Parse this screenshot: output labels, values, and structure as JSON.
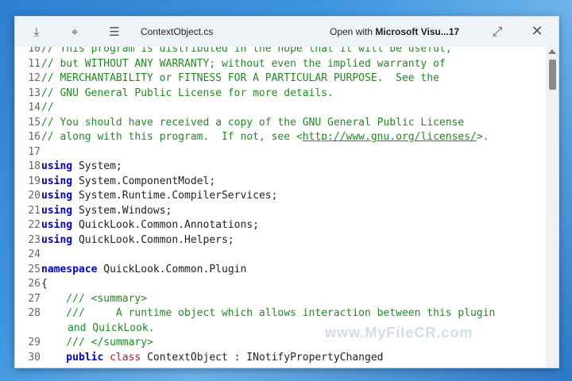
{
  "titlebar": {
    "file_name": "ContextObject.cs",
    "open_with_prefix": "Open with",
    "open_with_app": "Microsoft Visu...17",
    "icons": [
      "pin-top-icon",
      "pin-icon",
      "list-icon",
      "fullscreen-icon",
      "close-icon"
    ]
  },
  "code": {
    "lines": [
      {
        "n": "10",
        "text": "// This program is distributed in the hope that it will be useful,"
      },
      {
        "n": "11",
        "text": "// but WITHOUT ANY WARRANTY; without even the implied warranty of"
      },
      {
        "n": "12",
        "text": "// MERCHANTABILITY or FITNESS FOR A PARTICULAR PURPOSE.  See the"
      },
      {
        "n": "13",
        "text": "// GNU General Public License for more details."
      },
      {
        "n": "14",
        "text": "//"
      },
      {
        "n": "15",
        "text": "// You should have received a copy of the GNU General Public License"
      },
      {
        "n": "16",
        "pre": "// along with this program.  If not, see <",
        "link": "http://www.gnu.org/licenses/",
        "post": ">."
      },
      {
        "n": "17",
        "text": ""
      },
      {
        "n": "18",
        "kw": "using",
        "rest": " System;"
      },
      {
        "n": "19",
        "kw": "using",
        "rest": " System.ComponentModel;"
      },
      {
        "n": "20",
        "kw": "using",
        "rest": " System.Runtime.CompilerServices;"
      },
      {
        "n": "21",
        "kw": "using",
        "rest": " System.Windows;"
      },
      {
        "n": "22",
        "kw": "using",
        "rest": " QuickLook.Common.Annotations;"
      },
      {
        "n": "23",
        "kw": "using",
        "rest": " QuickLook.Common.Helpers;"
      },
      {
        "n": "24",
        "text": ""
      },
      {
        "n": "25",
        "kw": "namespace",
        "rest": " QuickLook.Common.Plugin"
      },
      {
        "n": "26",
        "rest": "{"
      },
      {
        "n": "27",
        "text": "    /// <summary>"
      },
      {
        "n": "28",
        "text": "    ///     A runtime object which allows interaction between this plugin",
        "cont": "and QuickLook."
      },
      {
        "n": "29",
        "text": "    /// </summary>"
      },
      {
        "n": "30",
        "kw": "    public",
        "kw2": " class",
        "rest": " ContextObject : INotifyPropertyChanged"
      }
    ]
  },
  "watermark": "www.MyFileCR.com"
}
